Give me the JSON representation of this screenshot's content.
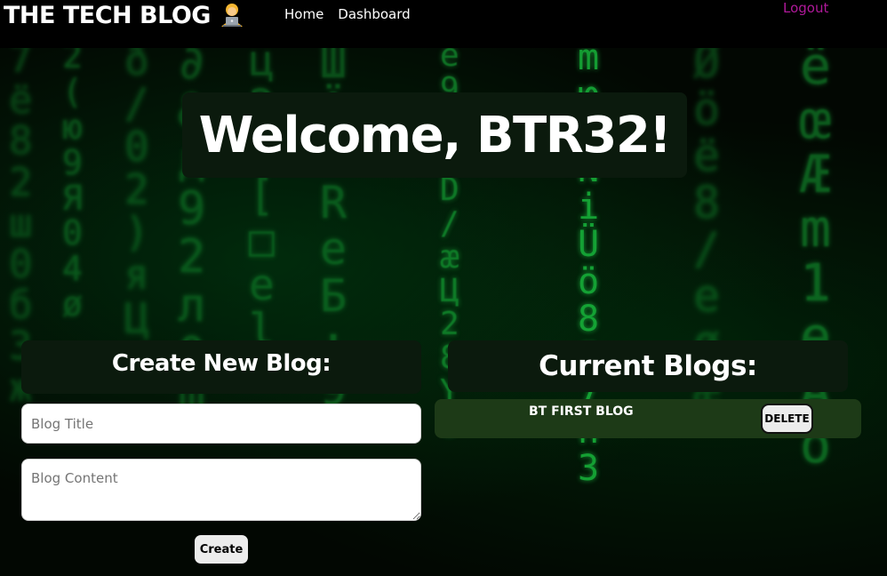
{
  "header": {
    "title": "THE TECH BLOG",
    "emoji_icon": "technologist-icon",
    "nav": {
      "home": "Home",
      "dashboard": "Dashboard"
    },
    "logout": "Logout"
  },
  "welcome": {
    "heading": "Welcome, BTR32!"
  },
  "create_blog": {
    "heading": "Create New Blog:",
    "title_placeholder": "Blog Title",
    "content_placeholder": "Blog Content",
    "button": "Create"
  },
  "current_blogs": {
    "heading": "Current Blogs:",
    "items": [
      {
        "title": "BT FIRST BLOG",
        "delete_label": "DELETE"
      }
    ]
  },
  "colors": {
    "background": "#000000",
    "panel": "#0b1a0d",
    "blog_row": "#1d3a17",
    "logout": "#b0199a",
    "matrix_green": "#19c23f"
  }
}
